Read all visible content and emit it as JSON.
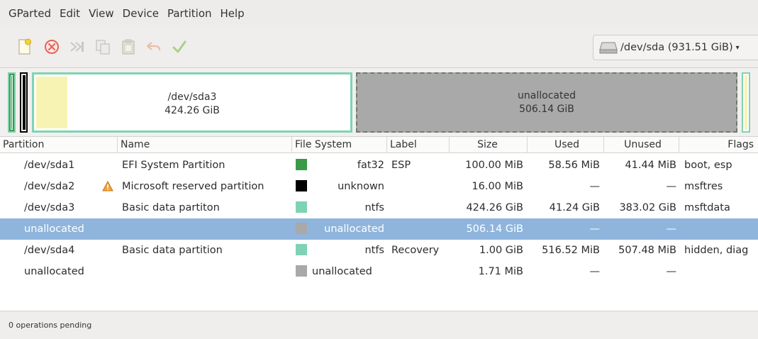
{
  "menubar": {
    "items": [
      "GParted",
      "Edit",
      "View",
      "Device",
      "Partition",
      "Help"
    ]
  },
  "toolbar": {
    "buttons": [
      {
        "name": "new-partition-icon",
        "enabled": true
      },
      {
        "name": "delete-icon",
        "enabled": true
      },
      {
        "name": "resize-move-icon",
        "enabled": false
      },
      {
        "name": "copy-icon",
        "enabled": false
      },
      {
        "name": "paste-icon",
        "enabled": false
      },
      {
        "name": "undo-icon",
        "enabled": false
      },
      {
        "name": "apply-icon",
        "enabled": false
      }
    ],
    "device_selector": "/dev/sda (931.51 GiB)"
  },
  "diskmap": {
    "segments": [
      {
        "name": "/dev/sda3",
        "size": "424.26 GiB",
        "fs_color": "#7fd3b4",
        "selected": false
      },
      {
        "name": "unallocated",
        "size": "506.14 GiB",
        "fs_color": "#a9a9a9",
        "selected": true
      }
    ]
  },
  "table": {
    "columns": [
      "Partition",
      "Name",
      "File System",
      "Label",
      "Size",
      "Used",
      "Unused",
      "Flags"
    ],
    "rows": [
      {
        "partition": "/dev/sda1",
        "name": "EFI System Partition",
        "fs_color": "#3a9a47",
        "fs": "fat32",
        "label": "ESP",
        "size": "100.00 MiB",
        "used": "58.56 MiB",
        "unused": "41.44 MiB",
        "flags": "boot, esp",
        "warning": false,
        "selected": false
      },
      {
        "partition": "/dev/sda2",
        "name": "Microsoft reserved partition",
        "fs_color": "#000000",
        "fs": "unknown",
        "label": "",
        "size": "16.00 MiB",
        "used": "—",
        "unused": "—",
        "flags": "msftres",
        "warning": true,
        "selected": false
      },
      {
        "partition": "/dev/sda3",
        "name": "Basic data partiton",
        "fs_color": "#7fd3b4",
        "fs": "ntfs",
        "label": "",
        "size": "424.26 GiB",
        "used": "41.24 GiB",
        "unused": "383.02 GiB",
        "flags": "msftdata",
        "warning": false,
        "selected": false
      },
      {
        "partition": "unallocated",
        "name": "",
        "fs_color": "#a9a9a9",
        "fs": "unallocated",
        "label": "",
        "size": "506.14 GiB",
        "used": "—",
        "unused": "—",
        "flags": "",
        "warning": false,
        "selected": true
      },
      {
        "partition": "/dev/sda4",
        "name": "Basic data partition",
        "fs_color": "#7fd3b4",
        "fs": "ntfs",
        "label": "Recovery",
        "size": "1.00 GiB",
        "used": "516.52 MiB",
        "unused": "507.48 MiB",
        "flags": "hidden, diag",
        "warning": false,
        "selected": false
      },
      {
        "partition": "unallocated",
        "name": "",
        "fs_color": "#a9a9a9",
        "fs": "unallocated",
        "label": "",
        "size": "1.71 MiB",
        "used": "—",
        "unused": "—",
        "flags": "",
        "warning": false,
        "selected": false
      }
    ]
  },
  "status": {
    "text": "0 operations pending"
  },
  "colors": {
    "selection": "#8fb5dd",
    "partition_border": "#7fd3b4",
    "unallocated": "#a9a9a9",
    "used_space": "#f7f3b3"
  }
}
